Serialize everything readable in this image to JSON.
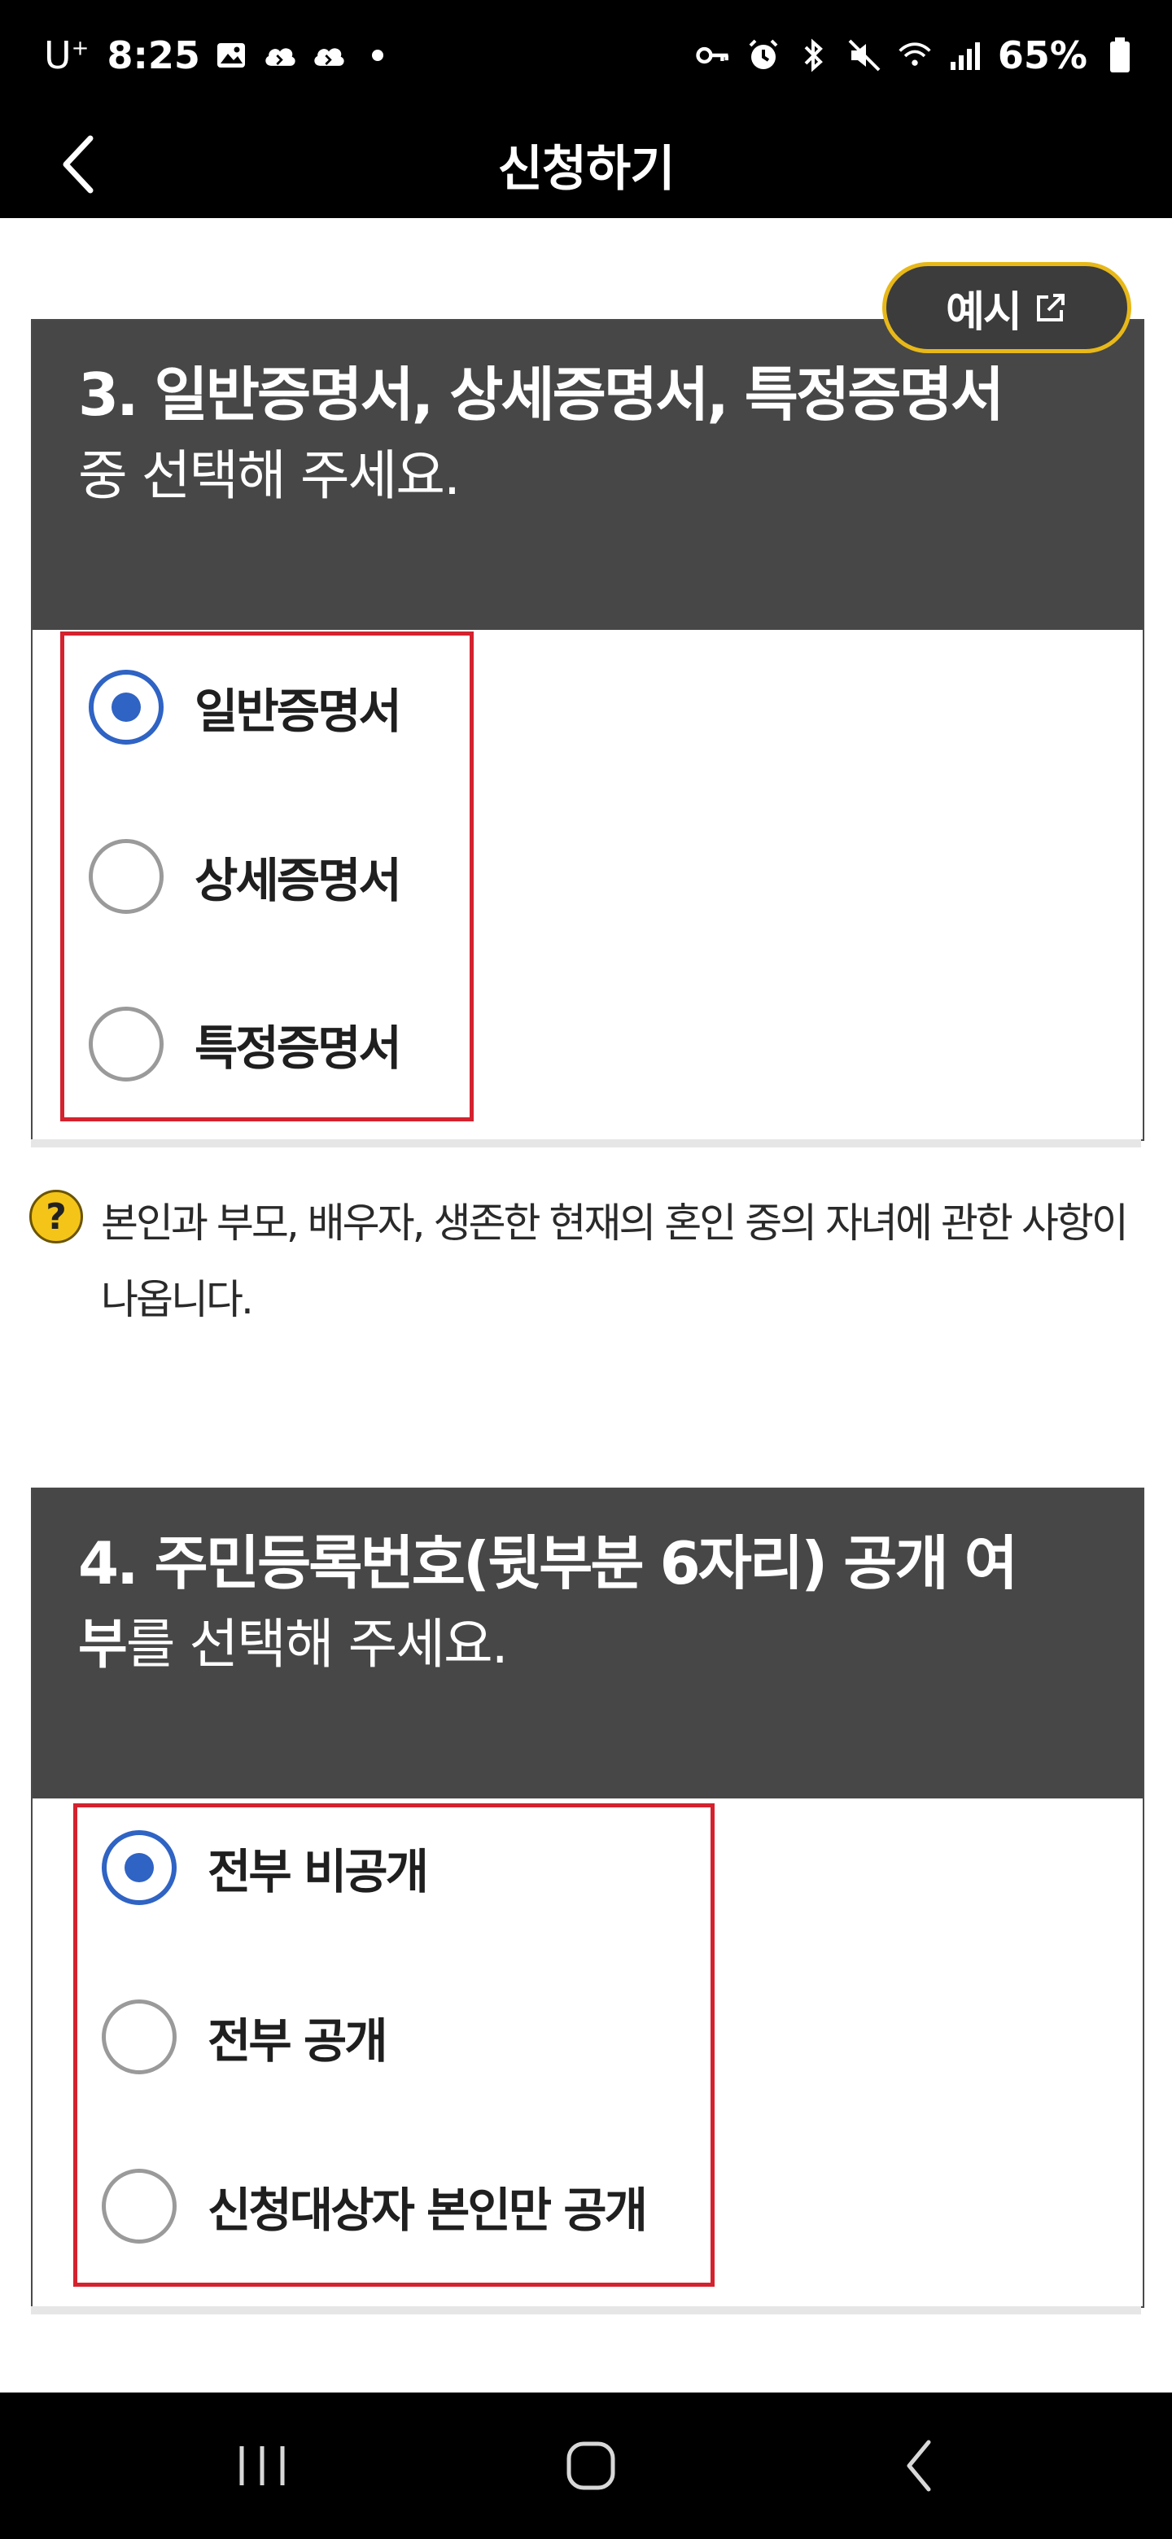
{
  "status_bar": {
    "carrier": "U",
    "carrier_sup": "+",
    "time": "8:25",
    "battery": "65%"
  },
  "header": {
    "title": "신청하기"
  },
  "example_button": {
    "label": "예시"
  },
  "question3": {
    "title": "3. 일반증명서, 상세증명서, 특정증명서",
    "subtitle": "중 선택해 주세요.",
    "options": [
      {
        "label": "일반증명서",
        "selected": true
      },
      {
        "label": "상세증명서",
        "selected": false
      },
      {
        "label": "특정증명서",
        "selected": false
      }
    ]
  },
  "help": {
    "icon": "?",
    "text": "본인과 부모, 배우자, 생존한 현재의 혼인 중의 자녀에 관한 사항이 나옵니다."
  },
  "question4": {
    "title_line1": "4. 주민등록번호(뒷부분 6자리) 공개 여",
    "title_line2_bold": "부",
    "title_line2_rest": "를 선택해 주세요.",
    "options": [
      {
        "label": "전부 비공개",
        "selected": true
      },
      {
        "label": "전부 공개",
        "selected": false
      },
      {
        "label": "신청대상자 본인만 공개",
        "selected": false
      }
    ]
  },
  "colors": {
    "accent_blue": "#2f63c4",
    "highlight_red": "#d4222e",
    "header_gray": "#474747",
    "badge_yellow": "#e8b818"
  }
}
